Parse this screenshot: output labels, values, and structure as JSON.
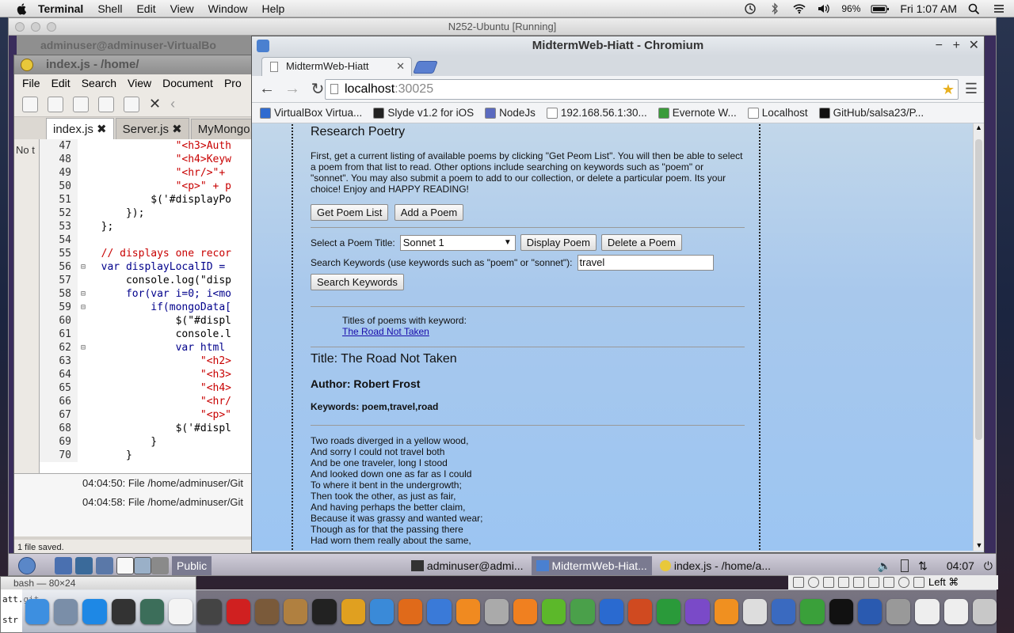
{
  "mac_menu": {
    "app_name": "Terminal",
    "items": [
      "Shell",
      "Edit",
      "View",
      "Window",
      "Help"
    ],
    "battery": "96%",
    "clock": "Fri 1:07 AM"
  },
  "vbox": {
    "title": "N252-Ubuntu [Running]",
    "status_label": "Left ⌘"
  },
  "editor": {
    "title": "index.js - /home/",
    "bg_title": "adminuser@adminuser-VirtualBo",
    "menu": [
      "File",
      "Edit",
      "Search",
      "View",
      "Document",
      "Pro"
    ],
    "tabs": [
      "index.js",
      "Server.js",
      "MyMongo.j"
    ],
    "side_label": "No t",
    "lines": [
      {
        "n": "47",
        "fold": "",
        "code": "              \"<h3>Auth"
      },
      {
        "n": "48",
        "fold": "",
        "code": "              \"<h4>Keyw"
      },
      {
        "n": "49",
        "fold": "",
        "code": "              \"<hr/>\"+"
      },
      {
        "n": "50",
        "fold": "",
        "code": "              \"<p>\" + p"
      },
      {
        "n": "51",
        "fold": "",
        "code": "          $('#displayPo"
      },
      {
        "n": "52",
        "fold": "",
        "code": "      });"
      },
      {
        "n": "53",
        "fold": "",
        "code": "  };"
      },
      {
        "n": "54",
        "fold": "",
        "code": ""
      },
      {
        "n": "55",
        "fold": "",
        "code": "  // displays one recor"
      },
      {
        "n": "56",
        "fold": "⊟",
        "code": "  var displayLocalID ="
      },
      {
        "n": "57",
        "fold": "",
        "code": "      console.log(\"disp"
      },
      {
        "n": "58",
        "fold": "⊟",
        "code": "      for(var i=0; i<mo"
      },
      {
        "n": "59",
        "fold": "⊟",
        "code": "          if(mongoData["
      },
      {
        "n": "60",
        "fold": "",
        "code": "              $(\"#displ"
      },
      {
        "n": "61",
        "fold": "",
        "code": "              console.l"
      },
      {
        "n": "62",
        "fold": "⊟",
        "code": "              var html"
      },
      {
        "n": "63",
        "fold": "",
        "code": "                  \"<h2>"
      },
      {
        "n": "64",
        "fold": "",
        "code": "                  \"<h3>"
      },
      {
        "n": "65",
        "fold": "",
        "code": "                  \"<h4>"
      },
      {
        "n": "66",
        "fold": "",
        "code": "                  \"<hr/"
      },
      {
        "n": "67",
        "fold": "",
        "code": "                  \"<p>\""
      },
      {
        "n": "68",
        "fold": "",
        "code": "              $('#displ"
      },
      {
        "n": "69",
        "fold": "",
        "code": "          }"
      },
      {
        "n": "70",
        "fold": "",
        "code": "      }"
      }
    ],
    "log": [
      "04:04:50: File /home/adminuser/Git",
      "04:04:58: File /home/adminuser/Git"
    ],
    "status": "1 file saved."
  },
  "chrome": {
    "window_title": "MidtermWeb-Hiatt - Chromium",
    "tab_title": "MidtermWeb-Hiatt",
    "url_host": "localhost",
    "url_port": ":30025",
    "bookmarks": [
      {
        "label": "VirtualBox Virtua...",
        "color": "#2f6bd0"
      },
      {
        "label": "Slyde v1.2 for iOS",
        "color": "#222222"
      },
      {
        "label": "NodeJs",
        "color": "#5b6abf"
      },
      {
        "label": "192.168.56.1:30...",
        "color": "#ffffff"
      },
      {
        "label": "Evernote W...",
        "color": "#3a9b3a"
      },
      {
        "label": "Localhost",
        "color": "#ffffff"
      },
      {
        "label": "GitHub/salsa23/P...",
        "color": "#111111"
      }
    ]
  },
  "page": {
    "heading": "Research Poetry",
    "description": "First, get a current listing of available poems by clicking \"Get Peom List\". You will then be able to select a poem from that list to read. Other options include searching on keywords such as \"poem\" or \"sonnet\". You may also submit a poem to add to our collection, or delete a particular poem. Its your choice! Enjoy and HAPPY READING!",
    "btn_get_list": "Get Poem List",
    "btn_add": "Add a Poem",
    "select_label": "Select a Poem Title:",
    "select_value": "Sonnet 1",
    "btn_display": "Display Poem",
    "btn_delete": "Delete a Poem",
    "keyword_label": "Search Keywords (use keywords such as \"poem\" or \"sonnet\"):",
    "keyword_value": "travel",
    "btn_search": "Search Keywords",
    "results_label": "Titles of poems with keyword:",
    "result_link": "The Road Not Taken",
    "poem_title": "Title: The Road Not Taken",
    "poem_author": "Author: Robert Frost",
    "poem_keywords": "Keywords: poem,travel,road",
    "poem_lines": [
      "Two roads diverged in a yellow wood,",
      "And sorry I could not travel both",
      "And be one traveler, long I stood",
      "And looked down one as far as I could",
      "To where it bent in the undergrowth;",
      "Then took the other, as just as fair,",
      "And having perhaps the better claim,",
      "Because it was grassy and wanted wear;",
      "Though as for that the passing there",
      "Had worn them really about the same,"
    ]
  },
  "guest_panel": {
    "workspace_label": "Public",
    "tasks": [
      "adminuser@admi...",
      "MidtermWeb-Hiat...",
      "index.js - /home/a..."
    ],
    "clock": "04:07"
  },
  "terminal": {
    "title": "bash — 80×24",
    "lines": [
      "att.git",
      "",
      "str"
    ]
  },
  "dock": {
    "items": [
      {
        "name": "finder-icon",
        "color": "#3d8fe0"
      },
      {
        "name": "launchpad-icon",
        "color": "#7a8ea8"
      },
      {
        "name": "app-store-icon",
        "color": "#1e88e5"
      },
      {
        "name": "dashboard-icon",
        "color": "#333333"
      },
      {
        "name": "time-machine-icon",
        "color": "#3c6e5a"
      },
      {
        "name": "calendar-icon",
        "color": "#f4f4f4"
      },
      {
        "name": "imovie-icon",
        "color": "#444444"
      },
      {
        "name": "red-app-icon",
        "color": "#d02020"
      },
      {
        "name": "photos-icon",
        "color": "#7a5a3a"
      },
      {
        "name": "iphoto-icon",
        "color": "#b08040"
      },
      {
        "name": "aperture-icon",
        "color": "#222222"
      },
      {
        "name": "chrome-icon",
        "color": "#e0a020"
      },
      {
        "name": "safari-icon",
        "color": "#3a8ad8"
      },
      {
        "name": "firefox-icon",
        "color": "#e06a1a"
      },
      {
        "name": "itunes-icon",
        "color": "#3a7ad8"
      },
      {
        "name": "ibooks-icon",
        "color": "#f08a20"
      },
      {
        "name": "preview-icon",
        "color": "#aaaaaa"
      },
      {
        "name": "vlc-icon",
        "color": "#f08020"
      },
      {
        "name": "spotify-icon",
        "color": "#5cb82a"
      },
      {
        "name": "evernote-icon",
        "color": "#4aa04a"
      },
      {
        "name": "word-icon",
        "color": "#2a6ad0"
      },
      {
        "name": "powerpoint-icon",
        "color": "#d04a20"
      },
      {
        "name": "excel-icon",
        "color": "#2a9a3a"
      },
      {
        "name": "sphere-icon",
        "color": "#7a4ac8"
      },
      {
        "name": "settings-icon",
        "color": "#f09020"
      },
      {
        "name": "file-icon",
        "color": "#dddddd"
      },
      {
        "name": "xcode-icon",
        "color": "#3a6ac0"
      },
      {
        "name": "node-icon",
        "color": "#3aa03a"
      },
      {
        "name": "terminal-icon",
        "color": "#111111"
      },
      {
        "name": "virtualbox-icon",
        "color": "#2a5ab0"
      },
      {
        "name": "monitor-icon",
        "color": "#999999"
      },
      {
        "name": "document-icon",
        "color": "#eeeeee"
      },
      {
        "name": "document-icon-2",
        "color": "#eeeeee"
      },
      {
        "name": "trash-icon",
        "color": "#c8c8c8"
      }
    ]
  }
}
